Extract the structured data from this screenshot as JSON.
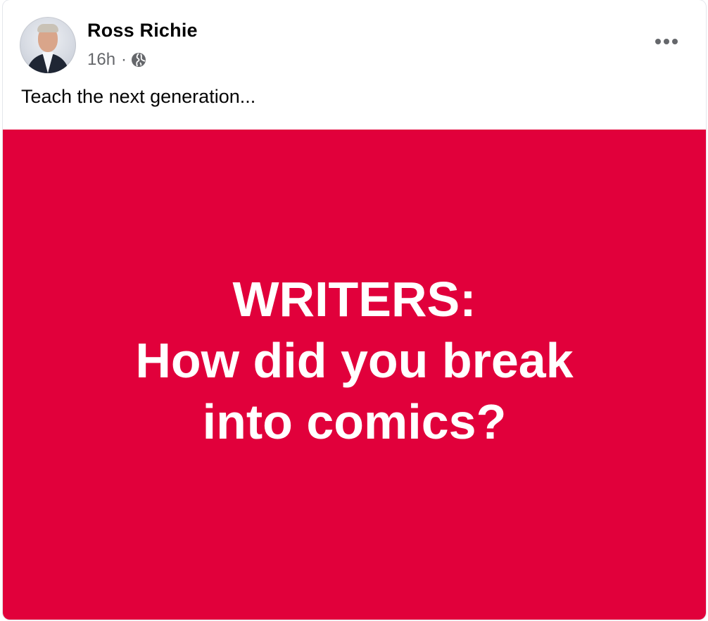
{
  "post": {
    "author": "Ross Richie",
    "timestamp": "16h",
    "separator": "·",
    "audience_icon": "globe-icon",
    "more_icon": "more-horizontal-icon",
    "text": "Teach the next generation...",
    "image": {
      "background_color": "#e1003b",
      "lines": [
        "WRITERS:",
        "How did you break",
        "into comics?"
      ]
    }
  }
}
